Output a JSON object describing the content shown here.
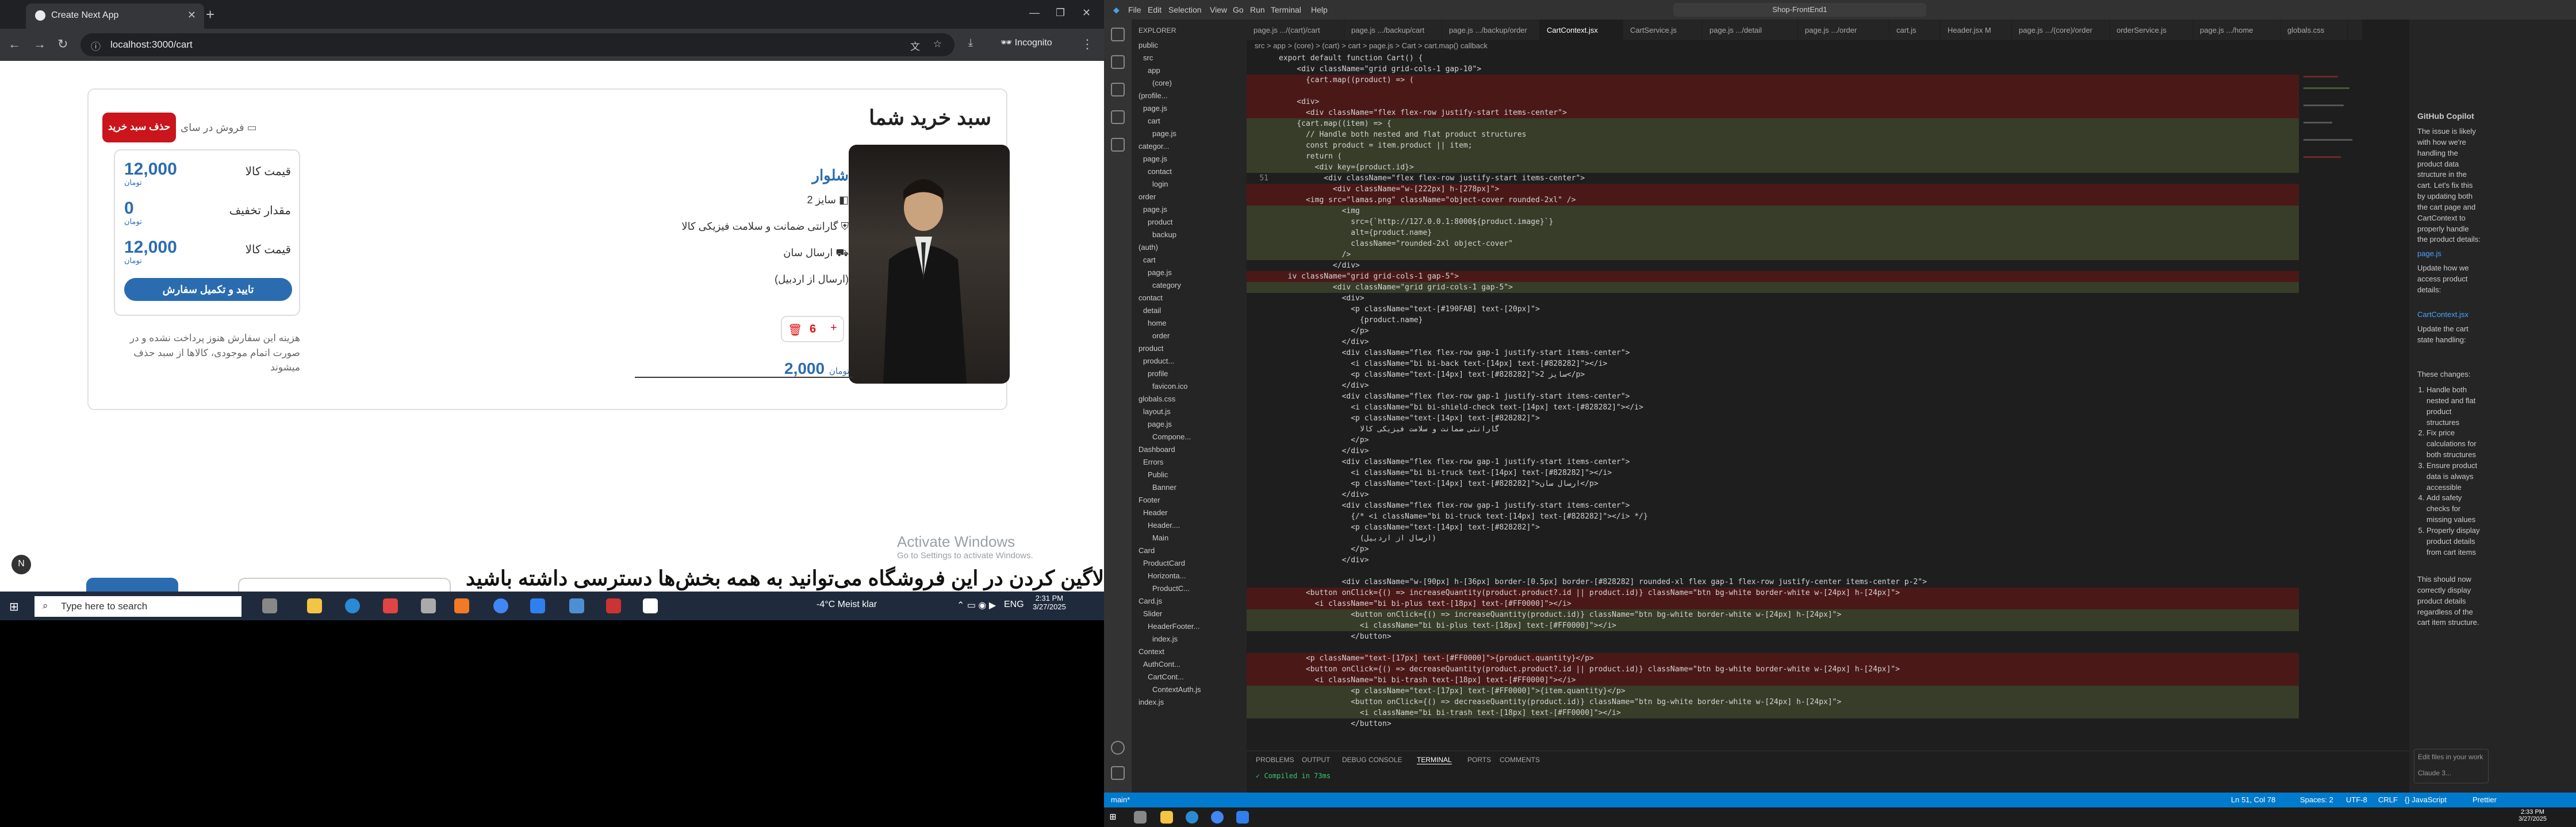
{
  "browser": {
    "tab_title": "Create Next App",
    "url": "localhost:3000/cart",
    "incognito_label": "Incognito"
  },
  "cart": {
    "title": "سبد خرید شما",
    "delete_cart_label": "حذف سبد خرید",
    "save_later_label": "فروش در سای",
    "product_name": "شلوار",
    "product_lines": [
      "سایز 2",
      "گارانتی ضمانت و سلامت فیزیکی کالا",
      "ارسال سان",
      "(ارسال از اردبیل)"
    ],
    "quantity": "6",
    "product_price": "2,000",
    "product_unit": "تومان",
    "summary": [
      {
        "label": "قیمت کالا",
        "value": "12,000",
        "unit": "تومان"
      },
      {
        "label": "مقدار تخفیف",
        "value": "0",
        "unit": "تومان"
      },
      {
        "label": "قیمت کالا",
        "value": "12,000",
        "unit": "تومان"
      }
    ],
    "confirm_label": "تایید و تکمیل سفارش",
    "note": "هزینه این سفارش هنوز پرداخت نشده و در صورت اتمام موجودی، کالاها از سبد حذف میشوند"
  },
  "activation": {
    "title": "Activate Windows",
    "subtitle": "Go to Settings to activate Windows."
  },
  "banner": "با لاگین کردن در این فروشگاه می‌توانید به همه بخش‌ها دسترسی داشته باشید",
  "taskbar": {
    "search_placeholder": "Type here to search",
    "weather": "-4°C  Meist klar",
    "lang": "ENG",
    "time": "2:31 PM",
    "date": "3/27/2025"
  },
  "vscode": {
    "menu": [
      "File",
      "Edit",
      "Selection",
      "View",
      "Go",
      "Run",
      "Terminal",
      "Help"
    ],
    "search": "Shop-FrontEnd1",
    "explorer_title": "EXPLORER",
    "tree": [
      "public",
      "src",
      "app",
      "(core)",
      "(profile...",
      "page.js",
      "cart",
      "page.js",
      "categor...",
      "page.js",
      "contact",
      "login",
      "order",
      "page.js",
      "product",
      "backup",
      "(auth)",
      "cart",
      "page.js",
      "category",
      "contact",
      "detail",
      "home",
      "order",
      "product",
      "product...",
      "profile",
      "favicon.ico",
      "globals.css",
      "layout.js",
      "page.js",
      "Compone...",
      "Dashboard",
      "Errors",
      "Public",
      "Banner",
      "Footer",
      "Header",
      "Header....",
      "Main",
      "Card",
      "ProductCard",
      "Horizonta...",
      "ProductC...",
      "Card.js",
      "Slider",
      "HeaderFooter...",
      "index.js",
      "Context",
      "AuthCont...",
      "CartCont...",
      "ContextAuth.js",
      "index.js"
    ],
    "tabs": [
      "page.js .../(cart)/cart",
      "page.js .../backup/cart",
      "page.js .../backup/order",
      "CartContext.jsx",
      "CartService.js",
      "page.js .../detail",
      "page.js .../order",
      "cart.js",
      "Header.jsx M",
      "page.js .../(core)/order",
      "orderService.js",
      "page.js .../home",
      "globals.css"
    ],
    "active_tab": 3,
    "breadcrumb": "src > app > (core) > (cart) > cart > page.js > Cart > cart.map() callback",
    "code_lines": [
      {
        "n": "",
        "t": "export default function Cart() {",
        "k": ""
      },
      {
        "n": "",
        "t": "    <div className=\"grid grid-cols-1 gap-10\">",
        "k": ""
      },
      {
        "n": "",
        "t": "      {cart.map((product) => (",
        "k": "rem"
      },
      {
        "n": "",
        "t": "",
        "k": "rem"
      },
      {
        "n": "",
        "t": "    <div>",
        "k": "rem"
      },
      {
        "n": "",
        "t": "      <div className=\"flex flex-row justify-start items-center\">",
        "k": "rem"
      },
      {
        "n": "",
        "t": "    {cart.map((item) => {",
        "k": "add"
      },
      {
        "n": "",
        "t": "      // Handle both nested and flat product structures",
        "k": "add"
      },
      {
        "n": "",
        "t": "      const product = item.product || item;",
        "k": "add"
      },
      {
        "n": "",
        "t": "      return (",
        "k": "add"
      },
      {
        "n": "",
        "t": "        <div key={product.id}>",
        "k": "add"
      },
      {
        "n": "51",
        "t": "          <div className=\"flex flex-row justify-start items-center\">",
        "k": ""
      },
      {
        "n": "",
        "t": "            <div className=\"w-[222px] h-[278px]\">",
        "k": "rem"
      },
      {
        "n": "",
        "t": "      <img src=\"lamas.png\" className=\"object-cover rounded-2xl\" />",
        "k": "rem"
      },
      {
        "n": "",
        "t": "              <img",
        "k": "add"
      },
      {
        "n": "",
        "t": "                src={`http://127.0.0.1:8000${product.image}`}",
        "k": "add"
      },
      {
        "n": "",
        "t": "                alt={product.name}",
        "k": "add"
      },
      {
        "n": "",
        "t": "                className=\"rounded-2xl object-cover\"",
        "k": "add"
      },
      {
        "n": "",
        "t": "              />",
        "k": "add"
      },
      {
        "n": "",
        "t": "            </div>",
        "k": ""
      },
      {
        "n": "",
        "t": "  iv className=\"grid grid-cols-1 gap-5\">",
        "k": "rem"
      },
      {
        "n": "",
        "t": "            <div className=\"grid grid-cols-1 gap-5\">",
        "k": "add"
      },
      {
        "n": "",
        "t": "              <div>",
        "k": ""
      },
      {
        "n": "",
        "t": "                <p className=\"text-[#190FAB] text-[20px]\">",
        "k": ""
      },
      {
        "n": "",
        "t": "                  {product.name}",
        "k": ""
      },
      {
        "n": "",
        "t": "                </p>",
        "k": ""
      },
      {
        "n": "",
        "t": "              </div>",
        "k": ""
      },
      {
        "n": "",
        "t": "              <div className=\"flex flex-row gap-1 justify-start items-center\">",
        "k": ""
      },
      {
        "n": "",
        "t": "                <i className=\"bi bi-back text-[14px] text-[#828282]\"></i>",
        "k": ""
      },
      {
        "n": "",
        "t": "                <p className=\"text-[14px] text-[#828282]\">سایز 2</p>",
        "k": ""
      },
      {
        "n": "",
        "t": "              </div>",
        "k": ""
      },
      {
        "n": "",
        "t": "              <div className=\"flex flex-row gap-1 justify-start items-center\">",
        "k": ""
      },
      {
        "n": "",
        "t": "                <i className=\"bi bi-shield-check text-[14px] text-[#828282]\"></i>",
        "k": ""
      },
      {
        "n": "",
        "t": "                <p className=\"text-[14px] text-[#828282]\">",
        "k": ""
      },
      {
        "n": "",
        "t": "                  گارانتی ضمانت و سلامت فیزیکی کالا",
        "k": ""
      },
      {
        "n": "",
        "t": "                </p>",
        "k": ""
      },
      {
        "n": "",
        "t": "              </div>",
        "k": ""
      },
      {
        "n": "",
        "t": "              <div className=\"flex flex-row gap-1 justify-start items-center\">",
        "k": ""
      },
      {
        "n": "",
        "t": "                <i className=\"bi bi-truck text-[14px] text-[#828282]\"></i>",
        "k": ""
      },
      {
        "n": "",
        "t": "                <p className=\"text-[14px] text-[#828282]\">ارسال سان</p>",
        "k": ""
      },
      {
        "n": "",
        "t": "              </div>",
        "k": ""
      },
      {
        "n": "",
        "t": "              <div className=\"flex flex-row gap-1 justify-start items-center\">",
        "k": ""
      },
      {
        "n": "",
        "t": "                {/* <i className=\"bi bi-truck text-[14px] text-[#828282]\"></i> */}",
        "k": ""
      },
      {
        "n": "",
        "t": "                <p className=\"text-[14px] text-[#828282]\">",
        "k": ""
      },
      {
        "n": "",
        "t": "                  (ارسال از اردبیل)",
        "k": ""
      },
      {
        "n": "",
        "t": "                </p>",
        "k": ""
      },
      {
        "n": "",
        "t": "              </div>",
        "k": ""
      },
      {
        "n": "",
        "t": "",
        "k": ""
      },
      {
        "n": "",
        "t": "              <div className=\"w-[90px] h-[36px] border-[0.5px] border-[#828282] rounded-xl flex gap-1 flex-row justify-center items-center p-2\">",
        "k": ""
      },
      {
        "n": "",
        "t": "      <button onClick={() => increaseQuantity(product.product?.id || product.id)} className=\"btn bg-white border-white w-[24px] h-[24px]\">",
        "k": "rem"
      },
      {
        "n": "",
        "t": "        <i className=\"bi bi-plus text-[18px] text-[#FF0000]\"></i>",
        "k": "rem"
      },
      {
        "n": "",
        "t": "                <button onClick={() => increaseQuantity(product.id)} className=\"btn bg-white border-white w-[24px] h-[24px]\">",
        "k": "add"
      },
      {
        "n": "",
        "t": "                  <i className=\"bi bi-plus text-[18px] text-[#FF0000]\"></i>",
        "k": "add"
      },
      {
        "n": "",
        "t": "                </button>",
        "k": ""
      },
      {
        "n": "",
        "t": "",
        "k": ""
      },
      {
        "n": "",
        "t": "      <p className=\"text-[17px] text-[#FF0000]\">{product.quantity}</p>",
        "k": "rem"
      },
      {
        "n": "",
        "t": "      <button onClick={() => decreaseQuantity(product.product?.id || product.id)} className=\"btn bg-white border-white w-[24px] h-[24px]\">",
        "k": "rem"
      },
      {
        "n": "",
        "t": "        <i className=\"bi bi-trash text-[18px] text-[#FF0000]\"></i>",
        "k": "rem"
      },
      {
        "n": "",
        "t": "                <p className=\"text-[17px] text-[#FF0000]\">{item.quantity}</p>",
        "k": "add"
      },
      {
        "n": "",
        "t": "                <button onClick={() => decreaseQuantity(product.id)} className=\"btn bg-white border-white w-[24px] h-[24px]\">",
        "k": "add"
      },
      {
        "n": "",
        "t": "                  <i className=\"bi bi-trash text-[18px] text-[#FF0000]\"></i>",
        "k": "add"
      },
      {
        "n": "",
        "t": "                </button>",
        "k": ""
      }
    ],
    "panel_tabs": [
      "PROBLEMS",
      "OUTPUT",
      "DEBUG CONSOLE",
      "TERMINAL",
      "PORTS",
      "COMMENTS"
    ],
    "terminal_line": "Compiled in 73ms",
    "status_left": "main*",
    "status_right": [
      "Ln 51, Col 78",
      "Spaces: 2",
      "UTF-8",
      "CRLF",
      "{} JavaScript",
      "Prettier"
    ],
    "chat_title": "GitHub Copilot",
    "chat_text": "The issue is likely with how we're handling the product data structure in the cart. Let's fix this by updating both the cart page and CartContext to properly handle the product details:",
    "chat_file1": "page.js",
    "chat_file1_desc": "Update how we access product details:",
    "chat_file2": "CartContext.jsx",
    "chat_file2_desc": "Update the cart state handling:",
    "chat_changes_title": "These changes:",
    "chat_changes": [
      "Handle both nested and flat product structures",
      "Fix price calculations for both structures",
      "Ensure product data is always accessible",
      "Add safety checks for missing values",
      "Properly display product details from cart items"
    ],
    "chat_footer": "This should now correctly display product details regardless of the cart item structure.",
    "chat_input": "Edit files in your work",
    "chat_model": "Claude 3...",
    "clock_time": "2:33 PM",
    "clock_date": "3/27/2025"
  }
}
